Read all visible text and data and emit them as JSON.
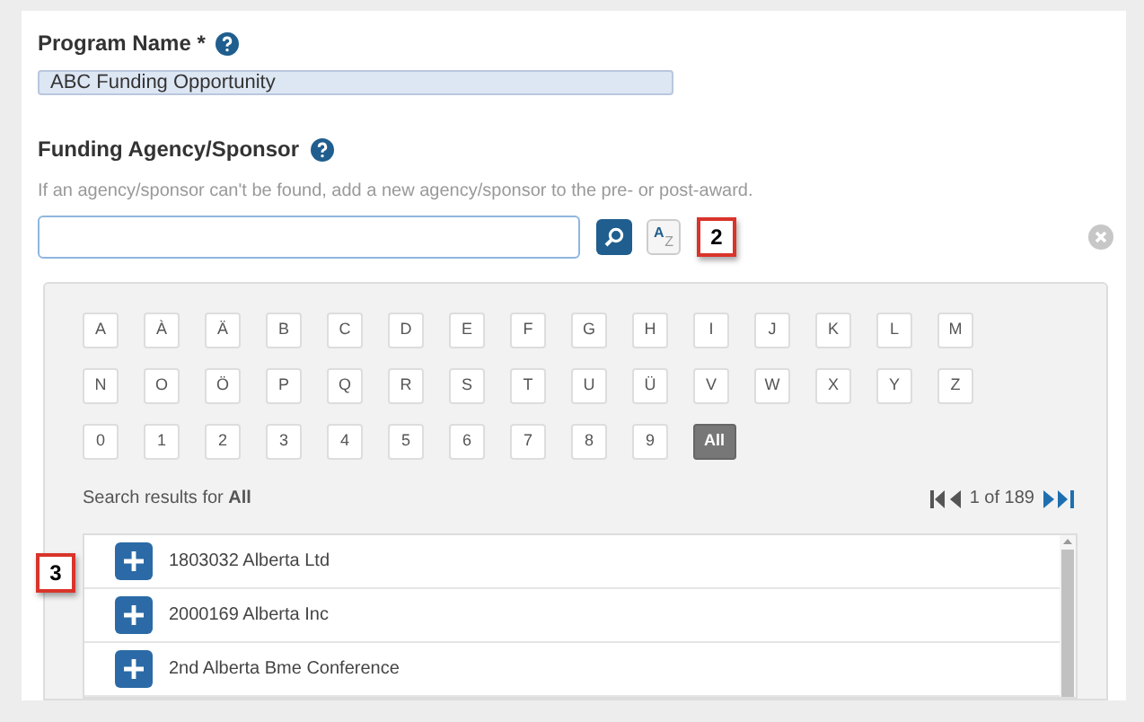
{
  "program_name": {
    "label": "Program Name *",
    "value": "ABC Funding Opportunity"
  },
  "funding_agency": {
    "label": "Funding Agency/Sponsor",
    "hint": "If an agency/sponsor can't be found, add a new agency/sponsor to the pre- or post-award.",
    "az_label_top": "A",
    "az_label_bottom": "Z",
    "callout": "2"
  },
  "letter_rows": [
    [
      {
        "label": "A",
        "selected": false
      },
      {
        "label": "À",
        "selected": false
      },
      {
        "label": "Ä",
        "selected": false
      },
      {
        "label": "B",
        "selected": false
      },
      {
        "label": "C",
        "selected": false
      },
      {
        "label": "D",
        "selected": false
      },
      {
        "label": "E",
        "selected": false
      },
      {
        "label": "F",
        "selected": false
      },
      {
        "label": "G",
        "selected": false
      },
      {
        "label": "H",
        "selected": false
      },
      {
        "label": "I",
        "selected": false
      },
      {
        "label": "J",
        "selected": false
      },
      {
        "label": "K",
        "selected": false
      },
      {
        "label": "L",
        "selected": false
      },
      {
        "label": "M",
        "selected": false
      }
    ],
    [
      {
        "label": "N",
        "selected": false
      },
      {
        "label": "O",
        "selected": false
      },
      {
        "label": "Ö",
        "selected": false
      },
      {
        "label": "P",
        "selected": false
      },
      {
        "label": "Q",
        "selected": false
      },
      {
        "label": "R",
        "selected": false
      },
      {
        "label": "S",
        "selected": false
      },
      {
        "label": "T",
        "selected": false
      },
      {
        "label": "U",
        "selected": false
      },
      {
        "label": "Ü",
        "selected": false
      },
      {
        "label": "V",
        "selected": false
      },
      {
        "label": "W",
        "selected": false
      },
      {
        "label": "X",
        "selected": false
      },
      {
        "label": "Y",
        "selected": false
      },
      {
        "label": "Z",
        "selected": false
      }
    ],
    [
      {
        "label": "0",
        "selected": false
      },
      {
        "label": "1",
        "selected": false
      },
      {
        "label": "2",
        "selected": false
      },
      {
        "label": "3",
        "selected": false
      },
      {
        "label": "4",
        "selected": false
      },
      {
        "label": "5",
        "selected": false
      },
      {
        "label": "6",
        "selected": false
      },
      {
        "label": "7",
        "selected": false
      },
      {
        "label": "8",
        "selected": false
      },
      {
        "label": "9",
        "selected": false
      },
      {
        "label": "All",
        "selected": true
      }
    ]
  ],
  "results": {
    "summary": "Search results for **All**",
    "pager": "1 of 189",
    "callout": "3",
    "items": [
      "1803032 Alberta Ltd",
      "2000169 Alberta Inc",
      "2nd Alberta Bme Conference"
    ]
  }
}
